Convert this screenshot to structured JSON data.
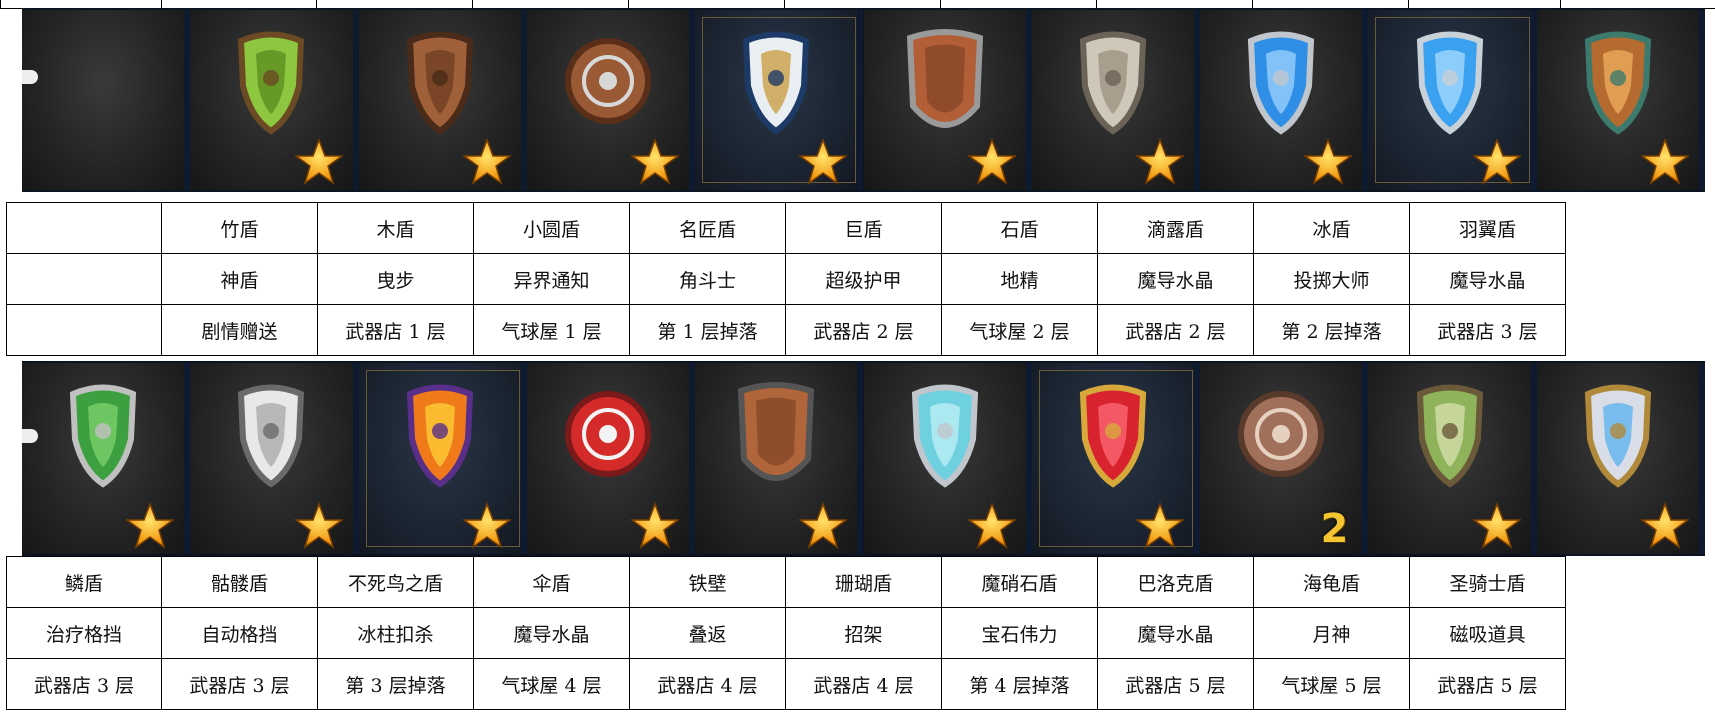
{
  "row1": {
    "items": [
      {
        "name": "",
        "skill": "",
        "source": "",
        "shield": "none",
        "bg": "dark",
        "badge": "none"
      },
      {
        "name": "竹盾",
        "skill": "神盾",
        "source": "剧情赠送",
        "shield": "bamboo",
        "bg": "dark",
        "badge": "star"
      },
      {
        "name": "木盾",
        "skill": "曳步",
        "source": "武器店 1 层",
        "shield": "wood",
        "bg": "dark",
        "badge": "star"
      },
      {
        "name": "小圆盾",
        "skill": "异界通知",
        "source": "气球屋 1 层",
        "shield": "round",
        "bg": "dark",
        "badge": "star"
      },
      {
        "name": "名匠盾",
        "skill": "角斗士",
        "source": "第 1 层掉落",
        "shield": "master",
        "bg": "blue",
        "badge": "star"
      },
      {
        "name": "巨盾",
        "skill": "超级护甲",
        "source": "武器店 2 层",
        "shield": "giant",
        "bg": "dark",
        "badge": "star"
      },
      {
        "name": "石盾",
        "skill": "地精",
        "source": "气球屋 2 层",
        "shield": "stone",
        "bg": "dark",
        "badge": "star"
      },
      {
        "name": "滴露盾",
        "skill": "魔导水晶",
        "source": "武器店 2 层",
        "shield": "dew",
        "bg": "dark",
        "badge": "star"
      },
      {
        "name": "冰盾",
        "skill": "投掷大师",
        "source": "第 2 层掉落",
        "shield": "ice",
        "bg": "blue",
        "badge": "star"
      },
      {
        "name": "羽翼盾",
        "skill": "魔导水晶",
        "source": "武器店 3 层",
        "shield": "feather",
        "bg": "dark",
        "badge": "star"
      }
    ]
  },
  "row2": {
    "items": [
      {
        "name": "鳞盾",
        "skill": "治疗格挡",
        "source": "武器店 3 层",
        "shield": "scale",
        "bg": "dark",
        "badge": "star"
      },
      {
        "name": "骷髅盾",
        "skill": "自动格挡",
        "source": "武器店 3 层",
        "shield": "skull",
        "bg": "dark",
        "badge": "star"
      },
      {
        "name": "不死鸟之盾",
        "skill": "冰柱扣杀",
        "source": "第 3 层掉落",
        "shield": "phoenix",
        "bg": "blue",
        "badge": "star"
      },
      {
        "name": "伞盾",
        "skill": "魔导水晶",
        "source": "气球屋 4 层",
        "shield": "umbrella",
        "bg": "dark",
        "badge": "star"
      },
      {
        "name": "铁壁",
        "skill": "叠返",
        "source": "武器店 4 层",
        "shield": "iron",
        "bg": "dark",
        "badge": "star"
      },
      {
        "name": "珊瑚盾",
        "skill": "招架",
        "source": "武器店 4 层",
        "shield": "coral",
        "bg": "dark",
        "badge": "star"
      },
      {
        "name": "魔硝石盾",
        "skill": "宝石伟力",
        "source": "第 4 层掉落",
        "shield": "ruby",
        "bg": "blue",
        "badge": "star"
      },
      {
        "name": "巴洛克盾",
        "skill": "魔导水晶",
        "source": "武器店 5 层",
        "shield": "baroque",
        "bg": "dark",
        "badge": "2"
      },
      {
        "name": "海龟盾",
        "skill": "月神",
        "source": "气球屋 5 层",
        "shield": "turtle",
        "bg": "dark",
        "badge": "star"
      },
      {
        "name": "圣骑士盾",
        "skill": "磁吸道具",
        "source": "武器店 5 层",
        "shield": "paladin",
        "bg": "dark",
        "badge": "star"
      }
    ]
  },
  "colors": {
    "bamboo": [
      "#8dc63f",
      "#5a8a1f",
      "#6b4a24"
    ],
    "wood": [
      "#a0603a",
      "#6e3d22",
      "#4a2a18"
    ],
    "round": [
      "#9b5a36",
      "#d8d8d8",
      "#5a2f1a"
    ],
    "master": [
      "#e9eef3",
      "#c99a3a",
      "#1d3a66"
    ],
    "giant": [
      "#b25f38",
      "#7a3d22",
      "#9a9a9a"
    ],
    "stone": [
      "#cfc8b8",
      "#9b9080",
      "#6b6357"
    ],
    "dew": [
      "#2f8fe6",
      "#9fd3ff",
      "#c0c6cc"
    ],
    "ice": [
      "#3aa0f0",
      "#a9dcff",
      "#c8d0d8"
    ],
    "feather": [
      "#b56a2f",
      "#f0b060",
      "#3c7a6e"
    ],
    "scale": [
      "#3da040",
      "#7fd36f",
      "#c0c0c0"
    ],
    "skull": [
      "#e8e8e8",
      "#a8a8a8",
      "#6a6a6a"
    ],
    "phoenix": [
      "#f07a1a",
      "#ffd23a",
      "#5a2f8a"
    ],
    "umbrella": [
      "#d42a2a",
      "#f2f2f2",
      "#7a1a1a"
    ],
    "iron": [
      "#b0653a",
      "#7a4022",
      "#555"
    ],
    "coral": [
      "#6fd0e0",
      "#bff0f6",
      "#c0c6cc"
    ],
    "ruby": [
      "#d8232e",
      "#ff6b78",
      "#d6a93a"
    ],
    "baroque": [
      "#a0705a",
      "#e6d0c0",
      "#5a3a2a"
    ],
    "turtle": [
      "#8fb35a",
      "#d8e0b0",
      "#6a5a3a"
    ],
    "paladin": [
      "#d8dde8",
      "#5ab0f0",
      "#b08a3a"
    ]
  }
}
